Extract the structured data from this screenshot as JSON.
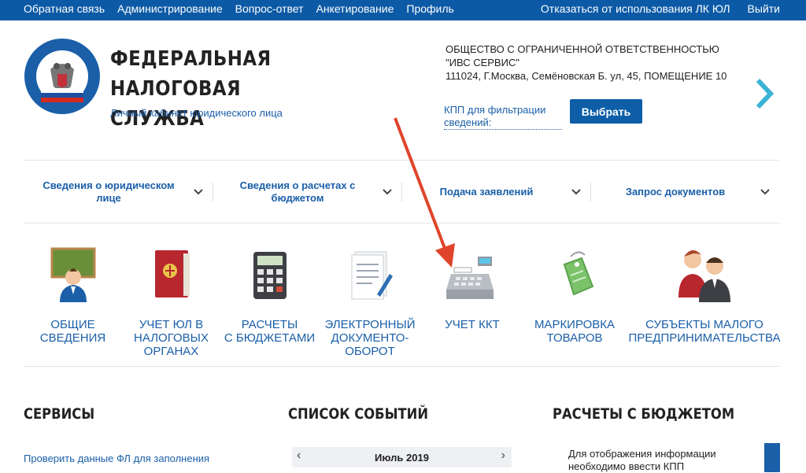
{
  "topbar": {
    "left_links": [
      "Обратная связь",
      "Администрирование",
      "Вопрос-ответ",
      "Анкетирование",
      "Профиль"
    ],
    "right_links": [
      "Отказаться от использования ЛК ЮЛ",
      "Выйти"
    ]
  },
  "brand": {
    "title_line1": "ФЕДЕРАЛЬНАЯ",
    "title_line2": "НАЛОГОВАЯ СЛУЖБА",
    "subtitle": "Личный кабинет юридического лица",
    "logo_text": "ФЕДЕРАЛЬНАЯ НАЛОГОВАЯ СЛУЖБА"
  },
  "org": {
    "name_line1": "ОБЩЕСТВО С ОГРАНИЧЕННОЙ ОТВЕТСТВЕННОСТЬЮ",
    "name_line2": "\"ИВС СЕРВИС\"",
    "address": "111024, Г.Москва, Семёновская Б. ул, 45, ПОМЕЩЕНИЕ 10",
    "kpp_link": "КПП для фильтрации сведений:",
    "select_button": "Выбрать"
  },
  "menu": [
    {
      "label": "Сведения о юридическом лице"
    },
    {
      "label": "Сведения о расчетах с бюджетом"
    },
    {
      "label": "Подача заявлений"
    },
    {
      "label": "Запрос документов"
    }
  ],
  "tiles": [
    {
      "line1": "ОБЩИЕ",
      "line2": "СВЕДЕНИЯ",
      "line3": "",
      "icon": "teacher-icon"
    },
    {
      "line1": "УЧЕТ ЮЛ В",
      "line2": "НАЛОГОВЫХ",
      "line3": "ОРГАНАХ",
      "icon": "folder-emblem-icon"
    },
    {
      "line1": "РАСЧЕТЫ",
      "line2": "С БЮДЖЕТАМИ",
      "line3": "",
      "icon": "calculator-icon"
    },
    {
      "line1": "ЭЛЕКТРОННЫЙ",
      "line2": "ДОКУМЕНТО-",
      "line3": "ОБОРОТ",
      "icon": "document-pen-icon"
    },
    {
      "line1": "УЧЕТ ККТ",
      "line2": "",
      "line3": "",
      "icon": "cash-register-icon"
    },
    {
      "line1": "МАРКИРОВКА",
      "line2": "ТОВАРОВ",
      "line3": "",
      "icon": "price-tag-icon"
    },
    {
      "line1": "СУБЪЕКТЫ МАЛОГО",
      "line2": "ПРЕДПРИНИМАТЕЛЬСТВА",
      "line3": "",
      "icon": "people-icon"
    }
  ],
  "sections": {
    "services_title": "СЕРВИСЫ",
    "services_link": "Проверить данные ФЛ для заполнения",
    "events_title": "СПИСОК СОБЫТИЙ",
    "calendar_month": "Июль 2019",
    "budget_title": "РАСЧЕТЫ С БЮДЖЕТОМ",
    "budget_text": "Для отображения информации необходимо ввести КПП"
  },
  "colors": {
    "topbar": "#0c5aa6",
    "link": "#1a5fa8",
    "accent_arrow": "#e0452b",
    "next_arrow": "#3ab3d6"
  }
}
